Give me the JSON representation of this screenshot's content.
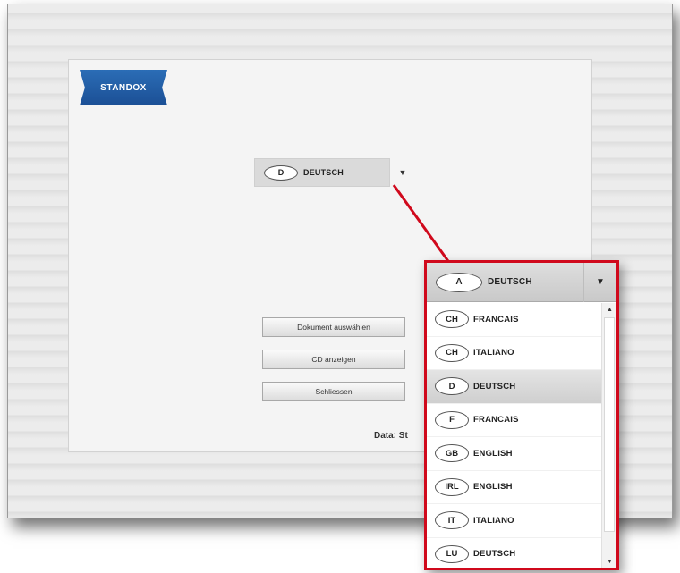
{
  "logo": {
    "text": "STANDOX"
  },
  "main_select": {
    "code": "D",
    "language": "DEUTSCH",
    "arrow": "▼"
  },
  "buttons": {
    "select_document": "Dokument auswählen",
    "show_cd": "CD anzeigen",
    "close": "Schliessen"
  },
  "footer": {
    "data_label": "Data: St"
  },
  "popup": {
    "current": {
      "code": "A",
      "language": "DEUTSCH",
      "arrow": "▼"
    },
    "items": [
      {
        "code": "CH",
        "language": "FRANCAIS"
      },
      {
        "code": "CH",
        "language": "ITALIANO"
      },
      {
        "code": "D",
        "language": "DEUTSCH",
        "selected": true
      },
      {
        "code": "F",
        "language": "FRANCAIS"
      },
      {
        "code": "GB",
        "language": "ENGLISH"
      },
      {
        "code": "IRL",
        "language": "ENGLISH"
      },
      {
        "code": "IT",
        "language": "ITALIANO"
      },
      {
        "code": "LU",
        "language": "DEUTSCH"
      }
    ],
    "scroll_up": "▲",
    "scroll_down": "▼"
  },
  "colors": {
    "callout": "#d0091c",
    "brand": "#1f5aa5"
  }
}
